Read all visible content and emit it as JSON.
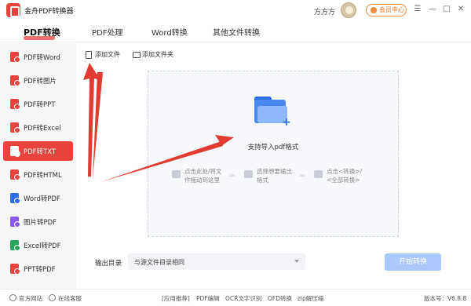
{
  "app": {
    "title": "金舟PDF转换器",
    "logo_icon": "pdf-logo-icon"
  },
  "user": {
    "name": "方方方",
    "vip_label": "会员中心"
  },
  "window_controls": [
    "☰",
    "—",
    "□",
    "✕"
  ],
  "topnav": {
    "tabs": [
      "PDF转换",
      "PDF处理",
      "Word转换",
      "其他文件转换"
    ],
    "active_index": 0
  },
  "sidebar": {
    "items": [
      {
        "label": "PDF转Word",
        "icon": "pdf-icon",
        "color": "#e8433d"
      },
      {
        "label": "PDF转图片",
        "icon": "pdf-icon",
        "color": "#e8433d"
      },
      {
        "label": "PDF转PPT",
        "icon": "pdf-icon",
        "color": "#e8433d"
      },
      {
        "label": "PDF转Excel",
        "icon": "pdf-icon",
        "color": "#e8433d"
      },
      {
        "label": "PDF转TXT",
        "icon": "pdf-icon",
        "color": "#e8433d",
        "active": true
      },
      {
        "label": "PDF转HTML",
        "icon": "pdf-icon",
        "color": "#e8433d"
      },
      {
        "label": "Word转PDF",
        "icon": "word-icon",
        "color": "#2d6ee8"
      },
      {
        "label": "图片转PDF",
        "icon": "image-icon",
        "color": "#8a5be8"
      },
      {
        "label": "Excel转PDF",
        "icon": "excel-icon",
        "color": "#27a55a"
      },
      {
        "label": "PPT转PDF",
        "icon": "ppt-icon",
        "color": "#e8433d"
      }
    ]
  },
  "toolbar": {
    "add_file": "添加文件",
    "add_folder": "添加文件夹"
  },
  "dropzone": {
    "text": "支持导入pdf格式",
    "steps": [
      {
        "line1": "点击此处/将文",
        "line2": "件拖动到这里"
      },
      {
        "line1": "选择想要输出",
        "line2": "格式"
      },
      {
        "line1": "点击<转换>/",
        "line2": "<全部转换>"
      }
    ],
    "step_arrow": "›››"
  },
  "output": {
    "label": "输出目录",
    "value": "与源文件目录相同"
  },
  "start_button": "开始转换",
  "footer": {
    "website": "官方网站",
    "support": "在线客服",
    "links": [
      "[应用推荐]",
      "PDF编辑",
      "OCR文字识别",
      "OFD转换",
      "zip解压缩"
    ],
    "version": "版本号：V6.8.8"
  },
  "colors": {
    "accent": "#e8433d",
    "primary": "#2d6ee8",
    "start_button": "#a9c8fb",
    "annotation_arrow": "#e23b32"
  }
}
